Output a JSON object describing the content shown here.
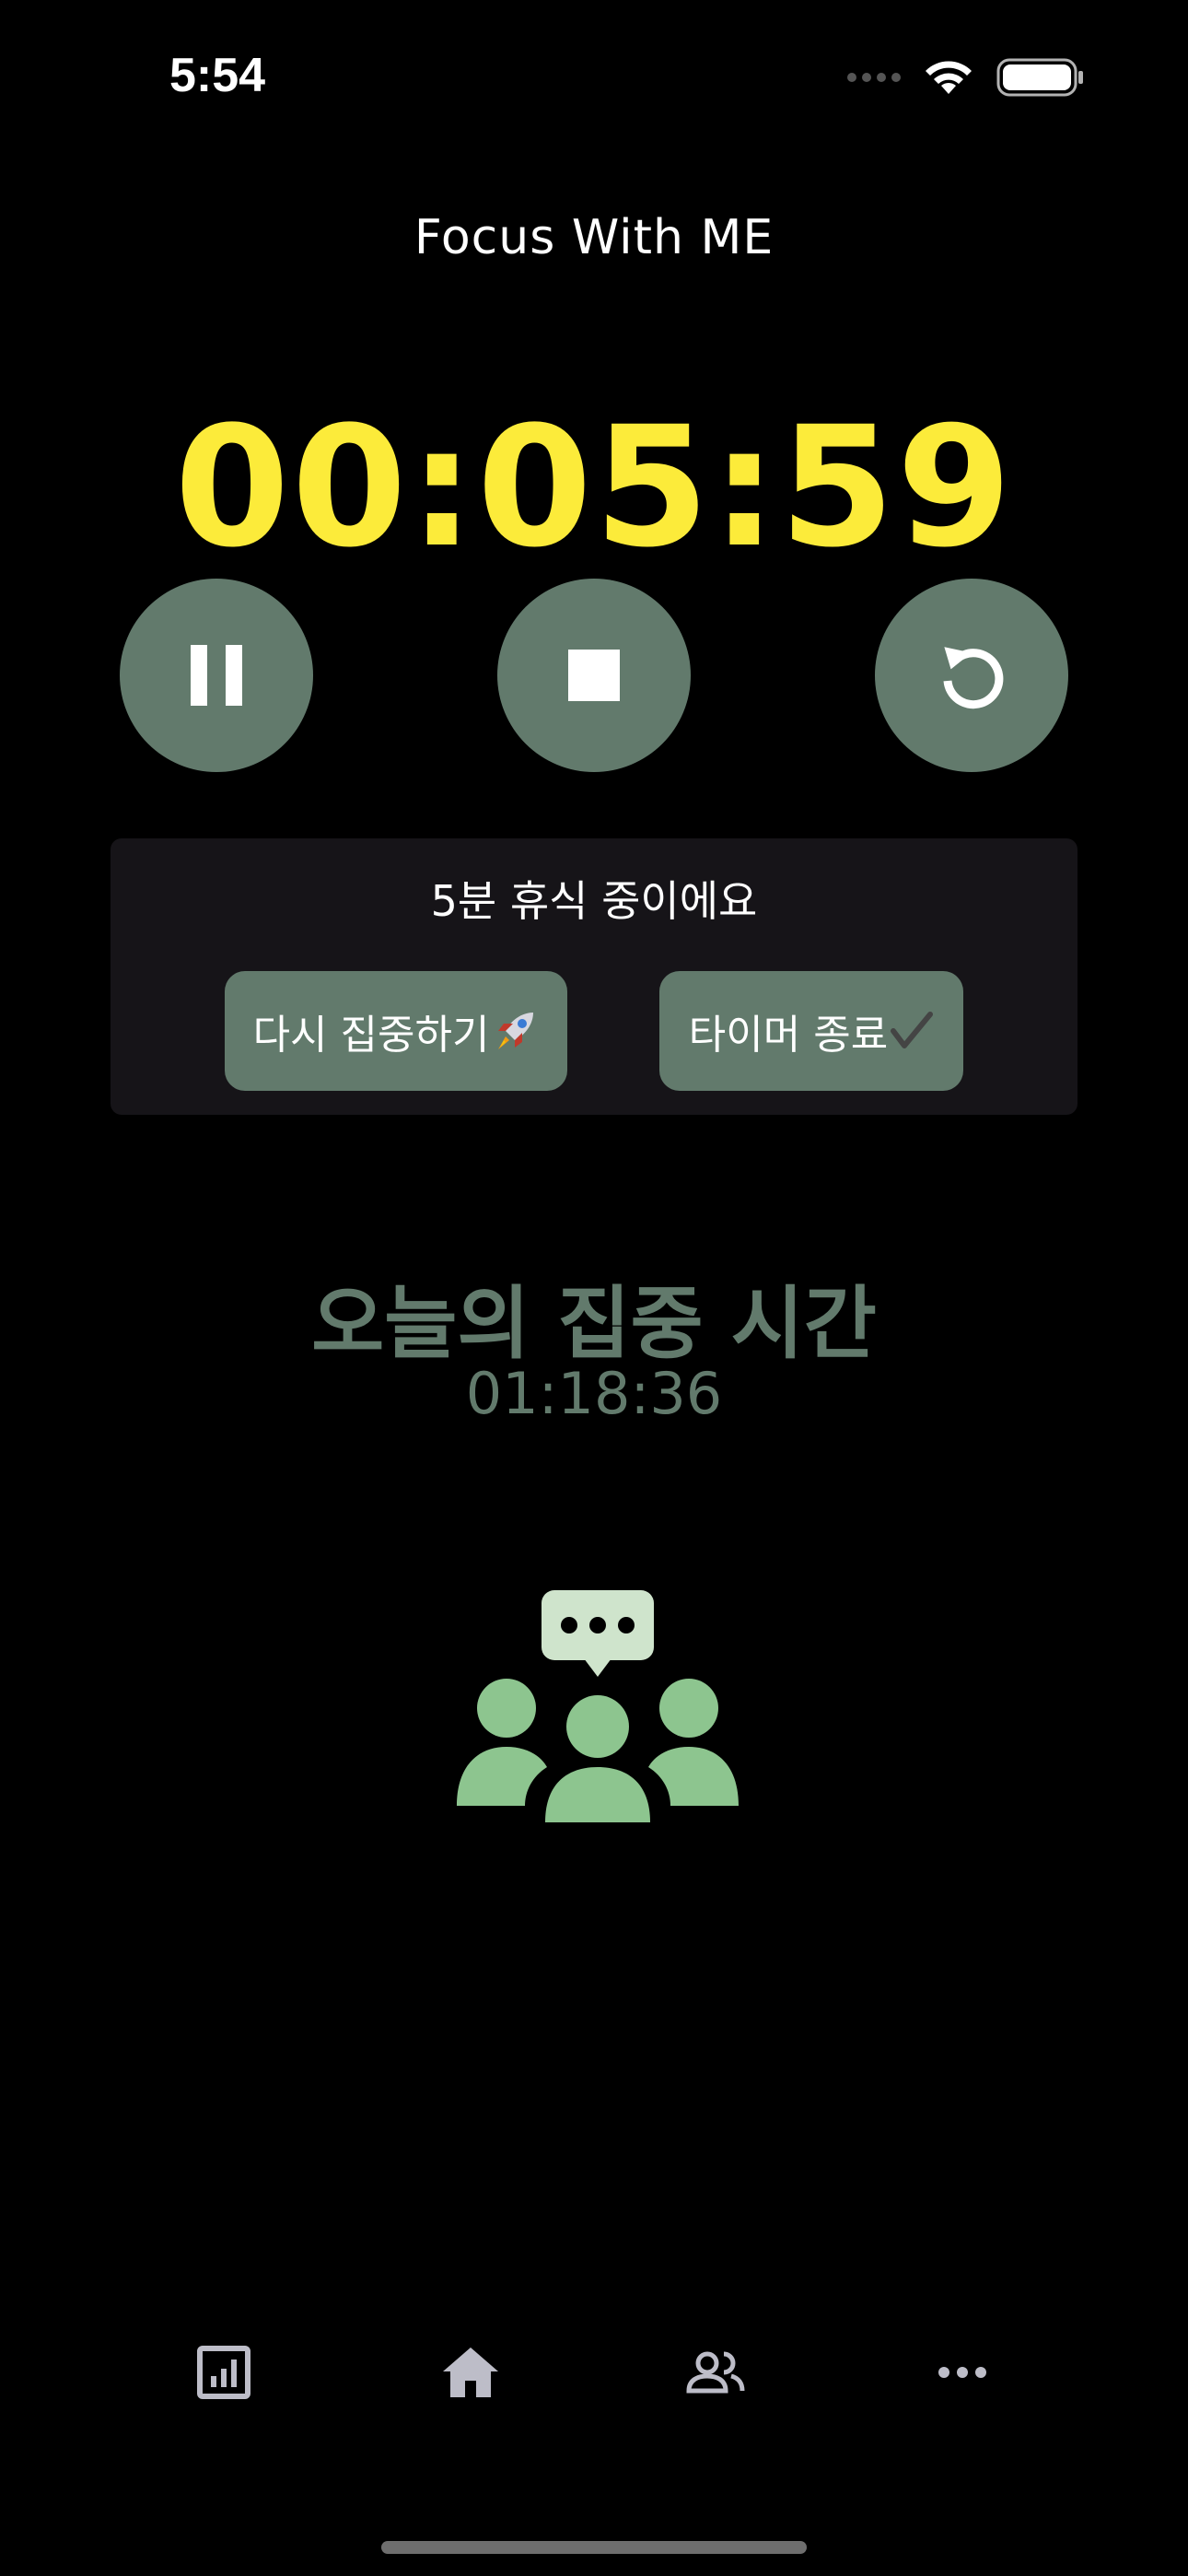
{
  "status_bar": {
    "time": "5:54",
    "icons": [
      "signal-icon",
      "wifi-icon",
      "battery-icon"
    ]
  },
  "app": {
    "title": "Focus With ME"
  },
  "timer": {
    "display": "00:05:59",
    "color": "#fceb3a"
  },
  "controls": [
    {
      "name": "pause",
      "icon": "pause-icon"
    },
    {
      "name": "stop",
      "icon": "stop-icon"
    },
    {
      "name": "reset",
      "icon": "reset-icon"
    }
  ],
  "break_panel": {
    "status": "5분  휴식 중이에요",
    "refocus_label": "다시 집중하기",
    "refocus_icon": "rocket-icon",
    "end_label": "타이머 종료",
    "end_icon": "checkmark-icon"
  },
  "today": {
    "label": "오늘의 집중 시간",
    "value": "01:18:36"
  },
  "illustration": {
    "icon": "group-chat-icon"
  },
  "tab_bar": {
    "items": [
      {
        "name": "stats",
        "icon": "chart-icon"
      },
      {
        "name": "home",
        "icon": "home-icon"
      },
      {
        "name": "people",
        "icon": "people-icon"
      },
      {
        "name": "more",
        "icon": "more-icon"
      }
    ]
  },
  "colors": {
    "accent": "#627a6c",
    "timer": "#fceb3a",
    "background": "#000000",
    "panel": "#161418",
    "illustration": "#8dc58f"
  }
}
